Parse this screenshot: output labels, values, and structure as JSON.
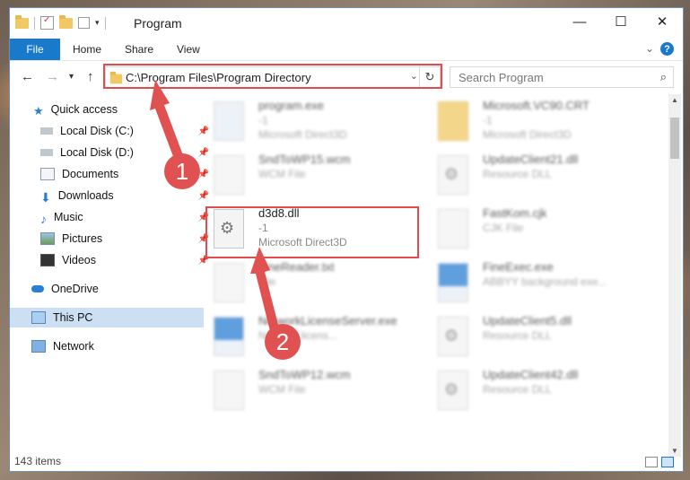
{
  "window": {
    "title": "Program",
    "controls": {
      "minimize": "—",
      "maximize": "☐",
      "close": "✕"
    }
  },
  "ribbon": {
    "tabs": [
      "File",
      "Home",
      "Share",
      "View"
    ],
    "expand_icon": "chevron-down-icon",
    "help": "?"
  },
  "navigation": {
    "back": "←",
    "forward": "→",
    "recent": "▾",
    "up": "↑",
    "address": "C:\\Program Files\\Program Directory",
    "dropdown": "⌄",
    "refresh": "↻",
    "search_placeholder": "Search Program",
    "search_icon": "⌕"
  },
  "sidebar": {
    "items": [
      {
        "label": "Quick access",
        "icon": "star-icon",
        "pinned": false
      },
      {
        "label": "Local Disk (C:)",
        "icon": "drive-icon",
        "pinned": true
      },
      {
        "label": "Local Disk (D:)",
        "icon": "drive-icon",
        "pinned": true
      },
      {
        "label": "Documents",
        "icon": "documents-icon",
        "pinned": true
      },
      {
        "label": "Downloads",
        "icon": "downloads-icon",
        "pinned": true
      },
      {
        "label": "Music",
        "icon": "music-icon",
        "pinned": true
      },
      {
        "label": "Pictures",
        "icon": "pictures-icon",
        "pinned": true
      },
      {
        "label": "Videos",
        "icon": "videos-icon",
        "pinned": true
      },
      {
        "label": "OneDrive",
        "icon": "cloud-icon",
        "pinned": false
      },
      {
        "label": "This PC",
        "icon": "pc-icon",
        "pinned": false,
        "selected": true
      },
      {
        "label": "Network",
        "icon": "network-icon",
        "pinned": false
      }
    ]
  },
  "files": {
    "left": [
      {
        "name": "program.exe",
        "line2": "-1",
        "line3": "Microsoft Direct3D",
        "type": "exe"
      },
      {
        "name": "SndToWP15.wcm",
        "line2": "WCM File",
        "line3": "",
        "type": "doc"
      },
      {
        "name": "d3d8.dll",
        "line2": "-1",
        "line3": "Microsoft Direct3D",
        "type": "dll",
        "highlighted": true
      },
      {
        "name": "FineReader.txt",
        "line2": "File",
        "line3": "",
        "type": "doc"
      },
      {
        "name": "NetworkLicenseServer.exe",
        "line2": "Network licens...",
        "line3": "",
        "type": "exe"
      },
      {
        "name": "SndToWP12.wcm",
        "line2": "WCM File",
        "line3": "",
        "type": "doc"
      }
    ],
    "right": [
      {
        "name": "Microsoft.VC90.CRT",
        "line2": "-1",
        "line3": "Microsoft Direct3D",
        "type": "folder"
      },
      {
        "name": "UpdateClient21.dll",
        "line2": "Resource DLL",
        "line3": "",
        "type": "dll"
      },
      {
        "name": "FastKom.cjk",
        "line2": "CJK File",
        "line3": "",
        "type": "doc"
      },
      {
        "name": "FineExec.exe",
        "line2": "ABBYY background exe...",
        "line3": "",
        "type": "exe"
      },
      {
        "name": "UpdateClient5.dll",
        "line2": "Resource DLL",
        "line3": "",
        "type": "dll"
      },
      {
        "name": "UpdateClient42.dll",
        "line2": "Resource DLL",
        "line3": "",
        "type": "dll"
      }
    ]
  },
  "status": {
    "item_count": "143 items"
  },
  "callouts": {
    "one": "1",
    "two": "2"
  },
  "colors": {
    "accent": "#1979ca",
    "highlight": "#e04b4b",
    "selected": "#ccdff3"
  }
}
